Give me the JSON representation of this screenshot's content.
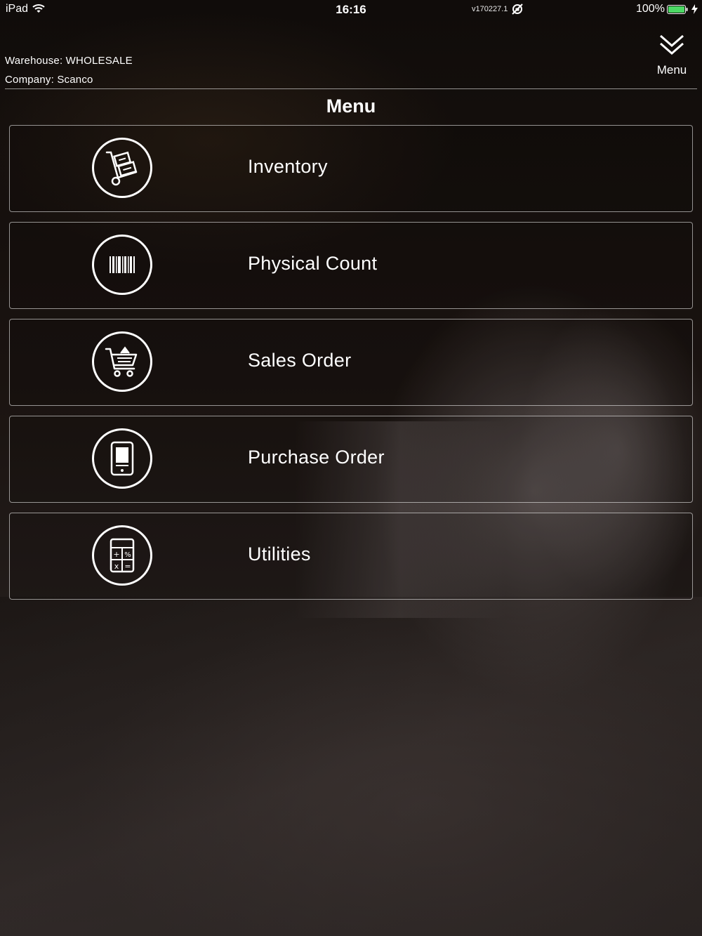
{
  "status_bar": {
    "device": "iPad",
    "time": "16:16",
    "version": "v170227.1",
    "battery_percent": "100%",
    "wifi_icon": "wifi-icon",
    "rotation_lock_icon": "rotation-lock-icon",
    "battery_icon": "battery-icon",
    "battery_color": "#4cd964"
  },
  "header": {
    "warehouse": "Warehouse: WHOLESALE",
    "company": "Company: Scanco",
    "menu_toggle_label": "Menu",
    "menu_toggle_icon": "double-chevron-down-icon"
  },
  "page": {
    "title": "Menu"
  },
  "menu": {
    "items": [
      {
        "label": "Inventory",
        "icon": "hand-truck-icon"
      },
      {
        "label": "Physical Count",
        "icon": "barcode-icon"
      },
      {
        "label": "Sales Order",
        "icon": "shopping-cart-icon"
      },
      {
        "label": "Purchase Order",
        "icon": "tablet-icon"
      },
      {
        "label": "Utilities",
        "icon": "calculator-icon"
      }
    ]
  }
}
